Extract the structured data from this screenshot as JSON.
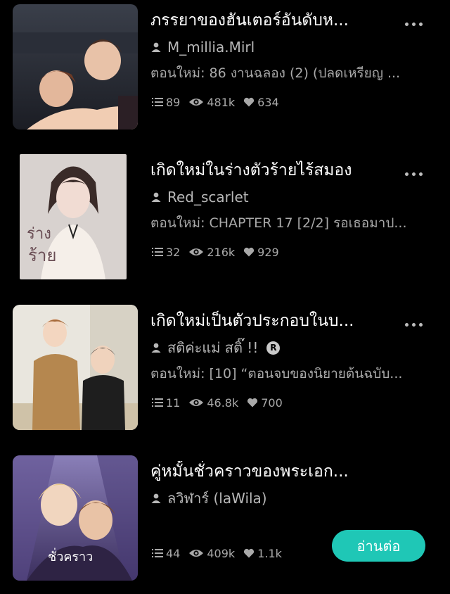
{
  "novels": [
    {
      "title": "ภรรยาของฮันเตอร์อันดับห...",
      "author": "M_millia.Mirl",
      "update": "ตอนใหม่: 86 งานฉลอง (2) (ปลดเหรียญ ...",
      "chapters": "89",
      "views": "481k",
      "likes": "634"
    },
    {
      "title": "เกิดใหม่ในร่างตัวร้ายไร้สมอง",
      "author": "Red_scarlet",
      "update": "ตอนใหม่: CHAPTER 17 [2/2] รอเธอมาป...",
      "chapters": "32",
      "views": "216k",
      "likes": "929"
    },
    {
      "title": "เกิดใหม่เป็นตัวประกอบในบ...",
      "author": "สติค่ะแม่ สติ๊ !!",
      "update": "ตอนใหม่: [10] “ตอนจบของนิยายต้นฉบับ...",
      "chapters": "11",
      "views": "46.8k",
      "likes": "700"
    },
    {
      "title": "คู่หมั้นชั่วคราวของพระเอก...",
      "author": "ลวิฬาร์ (laWila)",
      "update": "",
      "chapters": "44",
      "views": "409k",
      "likes": "1.1k"
    }
  ],
  "read_button": "อ่านต่อ",
  "colors": {
    "background": "#000000",
    "accent": "#1fc7b6",
    "muted_text": "#a9a9a9"
  }
}
